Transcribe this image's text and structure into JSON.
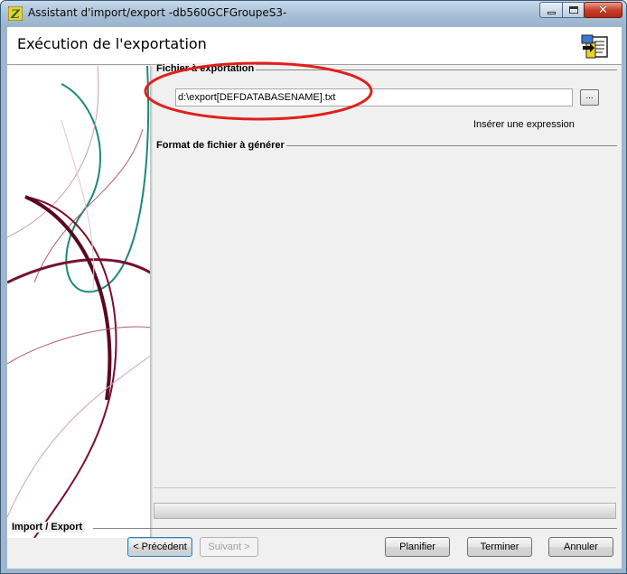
{
  "window": {
    "title": "Assistant d'import/export -db560GCFGroupeS3-"
  },
  "header": {
    "title": "Exécution de l'exportation"
  },
  "export_file": {
    "group_label": "Fichier à exportation",
    "path_value": "d:\\export[DEFDATABASENAME].txt",
    "browse_label": "...",
    "insert_expression_label": "Insérer une expression"
  },
  "format": {
    "group_label": "Format de fichier à générer"
  },
  "footer": {
    "group_label": "Import / Export",
    "previous_label": "< Précédent",
    "next_label": "Suivant >",
    "schedule_label": "Planifier",
    "finish_label": "Terminer",
    "cancel_label": "Annuler"
  },
  "colors": {
    "highlight_ellipse": "#e0201c",
    "art_teal": "#1a8a78",
    "art_maroon": "#7a1030"
  },
  "icons": {
    "app": "app-wizard-icon",
    "header": "export-document-icon",
    "minimize": "minimize-icon",
    "maximize": "maximize-icon",
    "close": "close-icon"
  }
}
